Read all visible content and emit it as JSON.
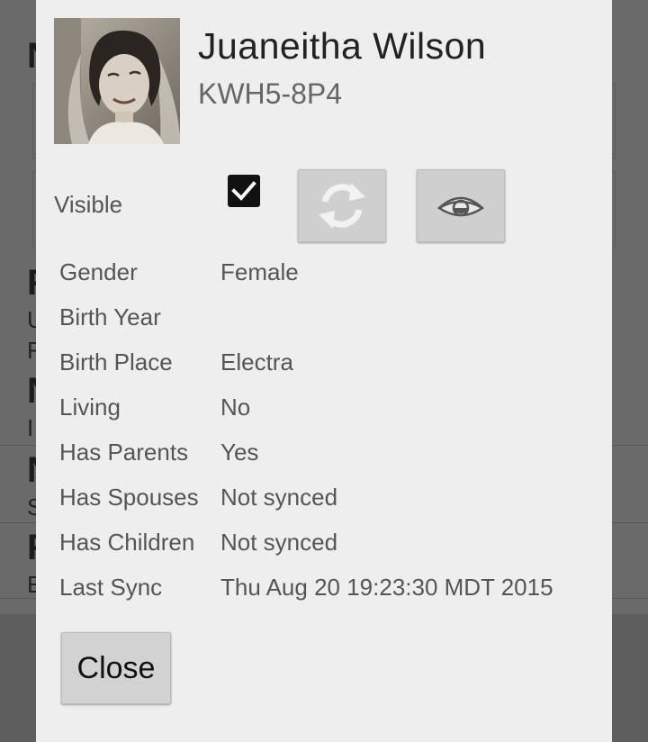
{
  "person": {
    "name": "Juaneitha Wilson",
    "id": "KWH5-8P4",
    "photo_icon": "portrait-photo"
  },
  "visible": {
    "label": "Visible",
    "checked": true
  },
  "actions": {
    "sync_icon": "refresh-icon",
    "view_icon": "eye-icon"
  },
  "details": [
    {
      "label": "Gender",
      "value": "Female"
    },
    {
      "label": "Birth Year",
      "value": ""
    },
    {
      "label": "Birth Place",
      "value": "Electra"
    },
    {
      "label": "Living",
      "value": "No"
    },
    {
      "label": "Has Parents",
      "value": "Yes"
    },
    {
      "label": "Has Spouses",
      "value": "Not synced"
    },
    {
      "label": "Has Children",
      "value": "Not synced"
    },
    {
      "label": "Last Sync",
      "value": "Thu Aug 20 19:23:30 MDT 2015"
    }
  ],
  "close_label": "Close",
  "colors": {
    "dialog_bg": "#eeeeee",
    "backdrop": "#6a6a6a",
    "button_bg": "#cfcfcf",
    "label_text": "#555555"
  }
}
